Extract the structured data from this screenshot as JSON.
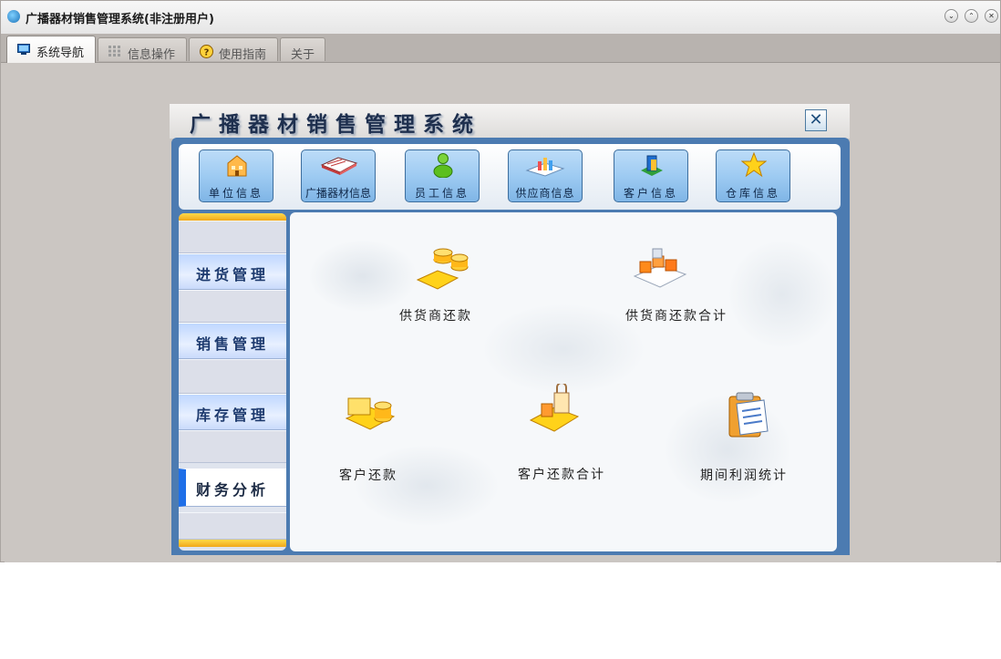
{
  "window": {
    "title": "广播器材销售管理系统(非注册用户)",
    "controls": {
      "minimize": "⌄",
      "restore": "⌃",
      "close": "✕"
    }
  },
  "tabs": [
    {
      "label": "系统导航",
      "active": true,
      "icon": "monitor-icon"
    },
    {
      "label": "信息操作",
      "active": false,
      "icon": "grid-icon"
    },
    {
      "label": "使用指南",
      "active": false,
      "icon": "help-icon"
    },
    {
      "label": "关于",
      "active": false,
      "icon": ""
    }
  ],
  "panel": {
    "title": "广播器材销售管理系统",
    "close_label": "✕"
  },
  "toolbar": [
    {
      "label": "单位信息",
      "icon": "building-icon"
    },
    {
      "label": "广播器材信息",
      "icon": "book-icon"
    },
    {
      "label": "员工信息",
      "icon": "person-icon"
    },
    {
      "label": "供应商信息",
      "icon": "supplier-icon"
    },
    {
      "label": "客户信息",
      "icon": "customer-icon"
    },
    {
      "label": "仓库信息",
      "icon": "star-icon"
    }
  ],
  "sidebar": [
    {
      "label": "进货管理",
      "active": false
    },
    {
      "label": "销售管理",
      "active": false
    },
    {
      "label": "库存管理",
      "active": false
    },
    {
      "label": "财务分析",
      "active": true
    }
  ],
  "functions": [
    {
      "label": "供货商还款",
      "icon": "coins-icon"
    },
    {
      "label": "供货商还款合计",
      "icon": "cubes-icon"
    },
    {
      "label": "客户还款",
      "icon": "coins-cart-icon"
    },
    {
      "label": "客户还款合计",
      "icon": "lock-cart-icon"
    },
    {
      "label": "期间利润统计",
      "icon": "clipboard-icon"
    }
  ],
  "colors": {
    "accent": "#1f6fe8",
    "panel_blue": "#4c7bb1",
    "button_blue": "#9ecbf2",
    "stripe_gold": "#f0a81a"
  }
}
